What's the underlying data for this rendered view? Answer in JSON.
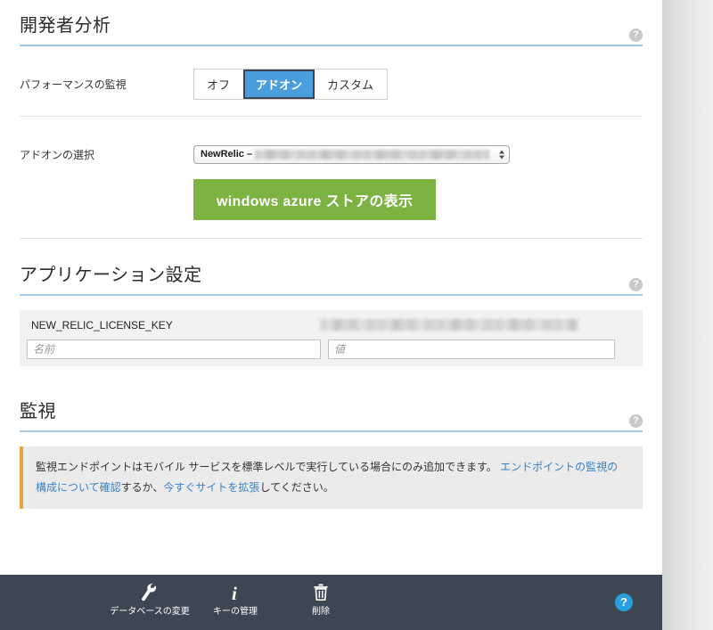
{
  "sections": {
    "developer_analytics": {
      "title": "開発者分析",
      "help_icon": "?",
      "perf_label": "パフォーマンスの監視",
      "segments": [
        {
          "label": "オフ",
          "selected": false
        },
        {
          "label": "アドオン",
          "selected": true
        },
        {
          "label": "カスタム",
          "selected": false
        }
      ],
      "addon_label": "アドオンの選択",
      "addon_select_value": "NewRelic –",
      "store_button": "windows azure ストアの表示"
    },
    "app_settings": {
      "title": "アプリケーション設定",
      "help_icon": "?",
      "rows": [
        {
          "key": "NEW_RELIC_LICENSE_KEY",
          "value": ""
        }
      ],
      "new_name_placeholder": "名前",
      "new_value_placeholder": "値"
    },
    "monitoring": {
      "title": "監視",
      "help_icon": "?",
      "message": {
        "part1": "監視エンドポイントはモバイル サービスを標準レベルで実行している場合にのみ追加できます。 ",
        "link1": "エンドポイントの監視の構成について確認",
        "part2": "するか、",
        "link2": "今すぐサイトを拡張",
        "part3": "してください。"
      }
    }
  },
  "toolbar": {
    "items": [
      {
        "label": "データベースの変更",
        "icon": "wrench-icon"
      },
      {
        "label": "キーの管理",
        "icon": "info-icon"
      },
      {
        "label": "削除",
        "icon": "trash-icon"
      }
    ],
    "help_label": "?"
  },
  "colors": {
    "accent_blue": "#4a9edd",
    "rule_blue": "#9fc5e8",
    "green": "#7cb342",
    "toolbar_bg": "#3d4754",
    "warning_orange": "#e8a33d",
    "link_blue": "#3b82c4"
  }
}
